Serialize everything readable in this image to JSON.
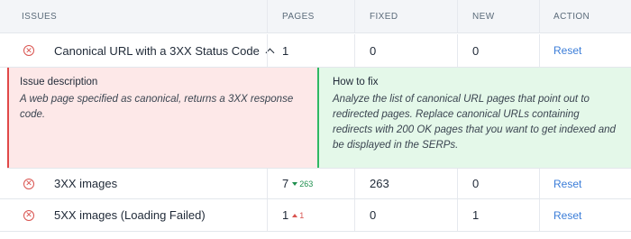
{
  "columns": {
    "issues": "ISSUES",
    "pages": "PAGES",
    "fixed": "FIXED",
    "new": "NEW",
    "action": "ACTION"
  },
  "rows": [
    {
      "icon": "error-circle-icon",
      "label": "Canonical URL with a 3XX Status Code",
      "expanded": true,
      "pages": "1",
      "fixed": "0",
      "new": "0",
      "action": "Reset"
    },
    {
      "icon": "error-circle-icon",
      "label": "3XX images",
      "pages": "7",
      "pages_delta": "263",
      "pages_delta_direction": "down",
      "fixed": "263",
      "new": "0",
      "action": "Reset"
    },
    {
      "icon": "error-circle-icon",
      "label": "5XX images (Loading Failed)",
      "pages": "1",
      "pages_delta": "1",
      "pages_delta_direction": "up",
      "fixed": "0",
      "new": "1",
      "action": "Reset"
    }
  ],
  "details": {
    "description_title": "Issue description",
    "description_text": "A web page specified as canonical, returns a 3XX response code.",
    "fix_title": "How to fix",
    "fix_text": "Analyze the list of canonical URL pages that point out to redirected pages. Replace canonical URLs containing redirects with 200 OK pages that you want to get indexed and be displayed in the SERPs."
  },
  "colors": {
    "error": "#d9534f",
    "link": "#3b7dd8",
    "delta_down": "#1f8f4e",
    "delta_up": "#d9534f",
    "description_bg": "#fde8e8",
    "fix_bg": "#e4f8e9"
  }
}
